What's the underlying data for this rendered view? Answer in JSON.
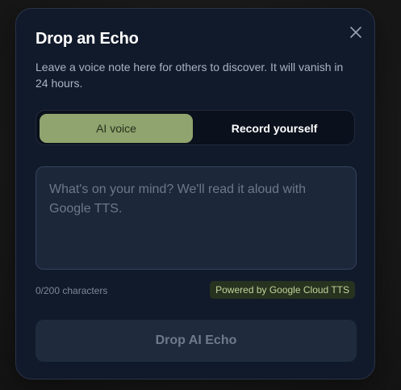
{
  "modal": {
    "title": "Drop an Echo",
    "subtitle": "Leave a voice note here for others to discover. It will vanish in 24 hours.",
    "close_icon": "close-icon"
  },
  "mode_toggle": {
    "options": [
      {
        "label": "AI voice",
        "active": true
      },
      {
        "label": "Record yourself",
        "active": false
      }
    ]
  },
  "message_input": {
    "value": "",
    "placeholder": "What's on your mind? We'll read it aloud with Google TTS."
  },
  "char_count": "0/200 characters",
  "tts_badge": "Powered by Google Cloud TTS",
  "submit_button": {
    "label": "Drop AI Echo",
    "enabled": false
  },
  "colors": {
    "modal_bg": "#111a2b",
    "accent_green": "#8fa46e",
    "badge_bg": "#27321f",
    "badge_text": "#c3d39a"
  }
}
